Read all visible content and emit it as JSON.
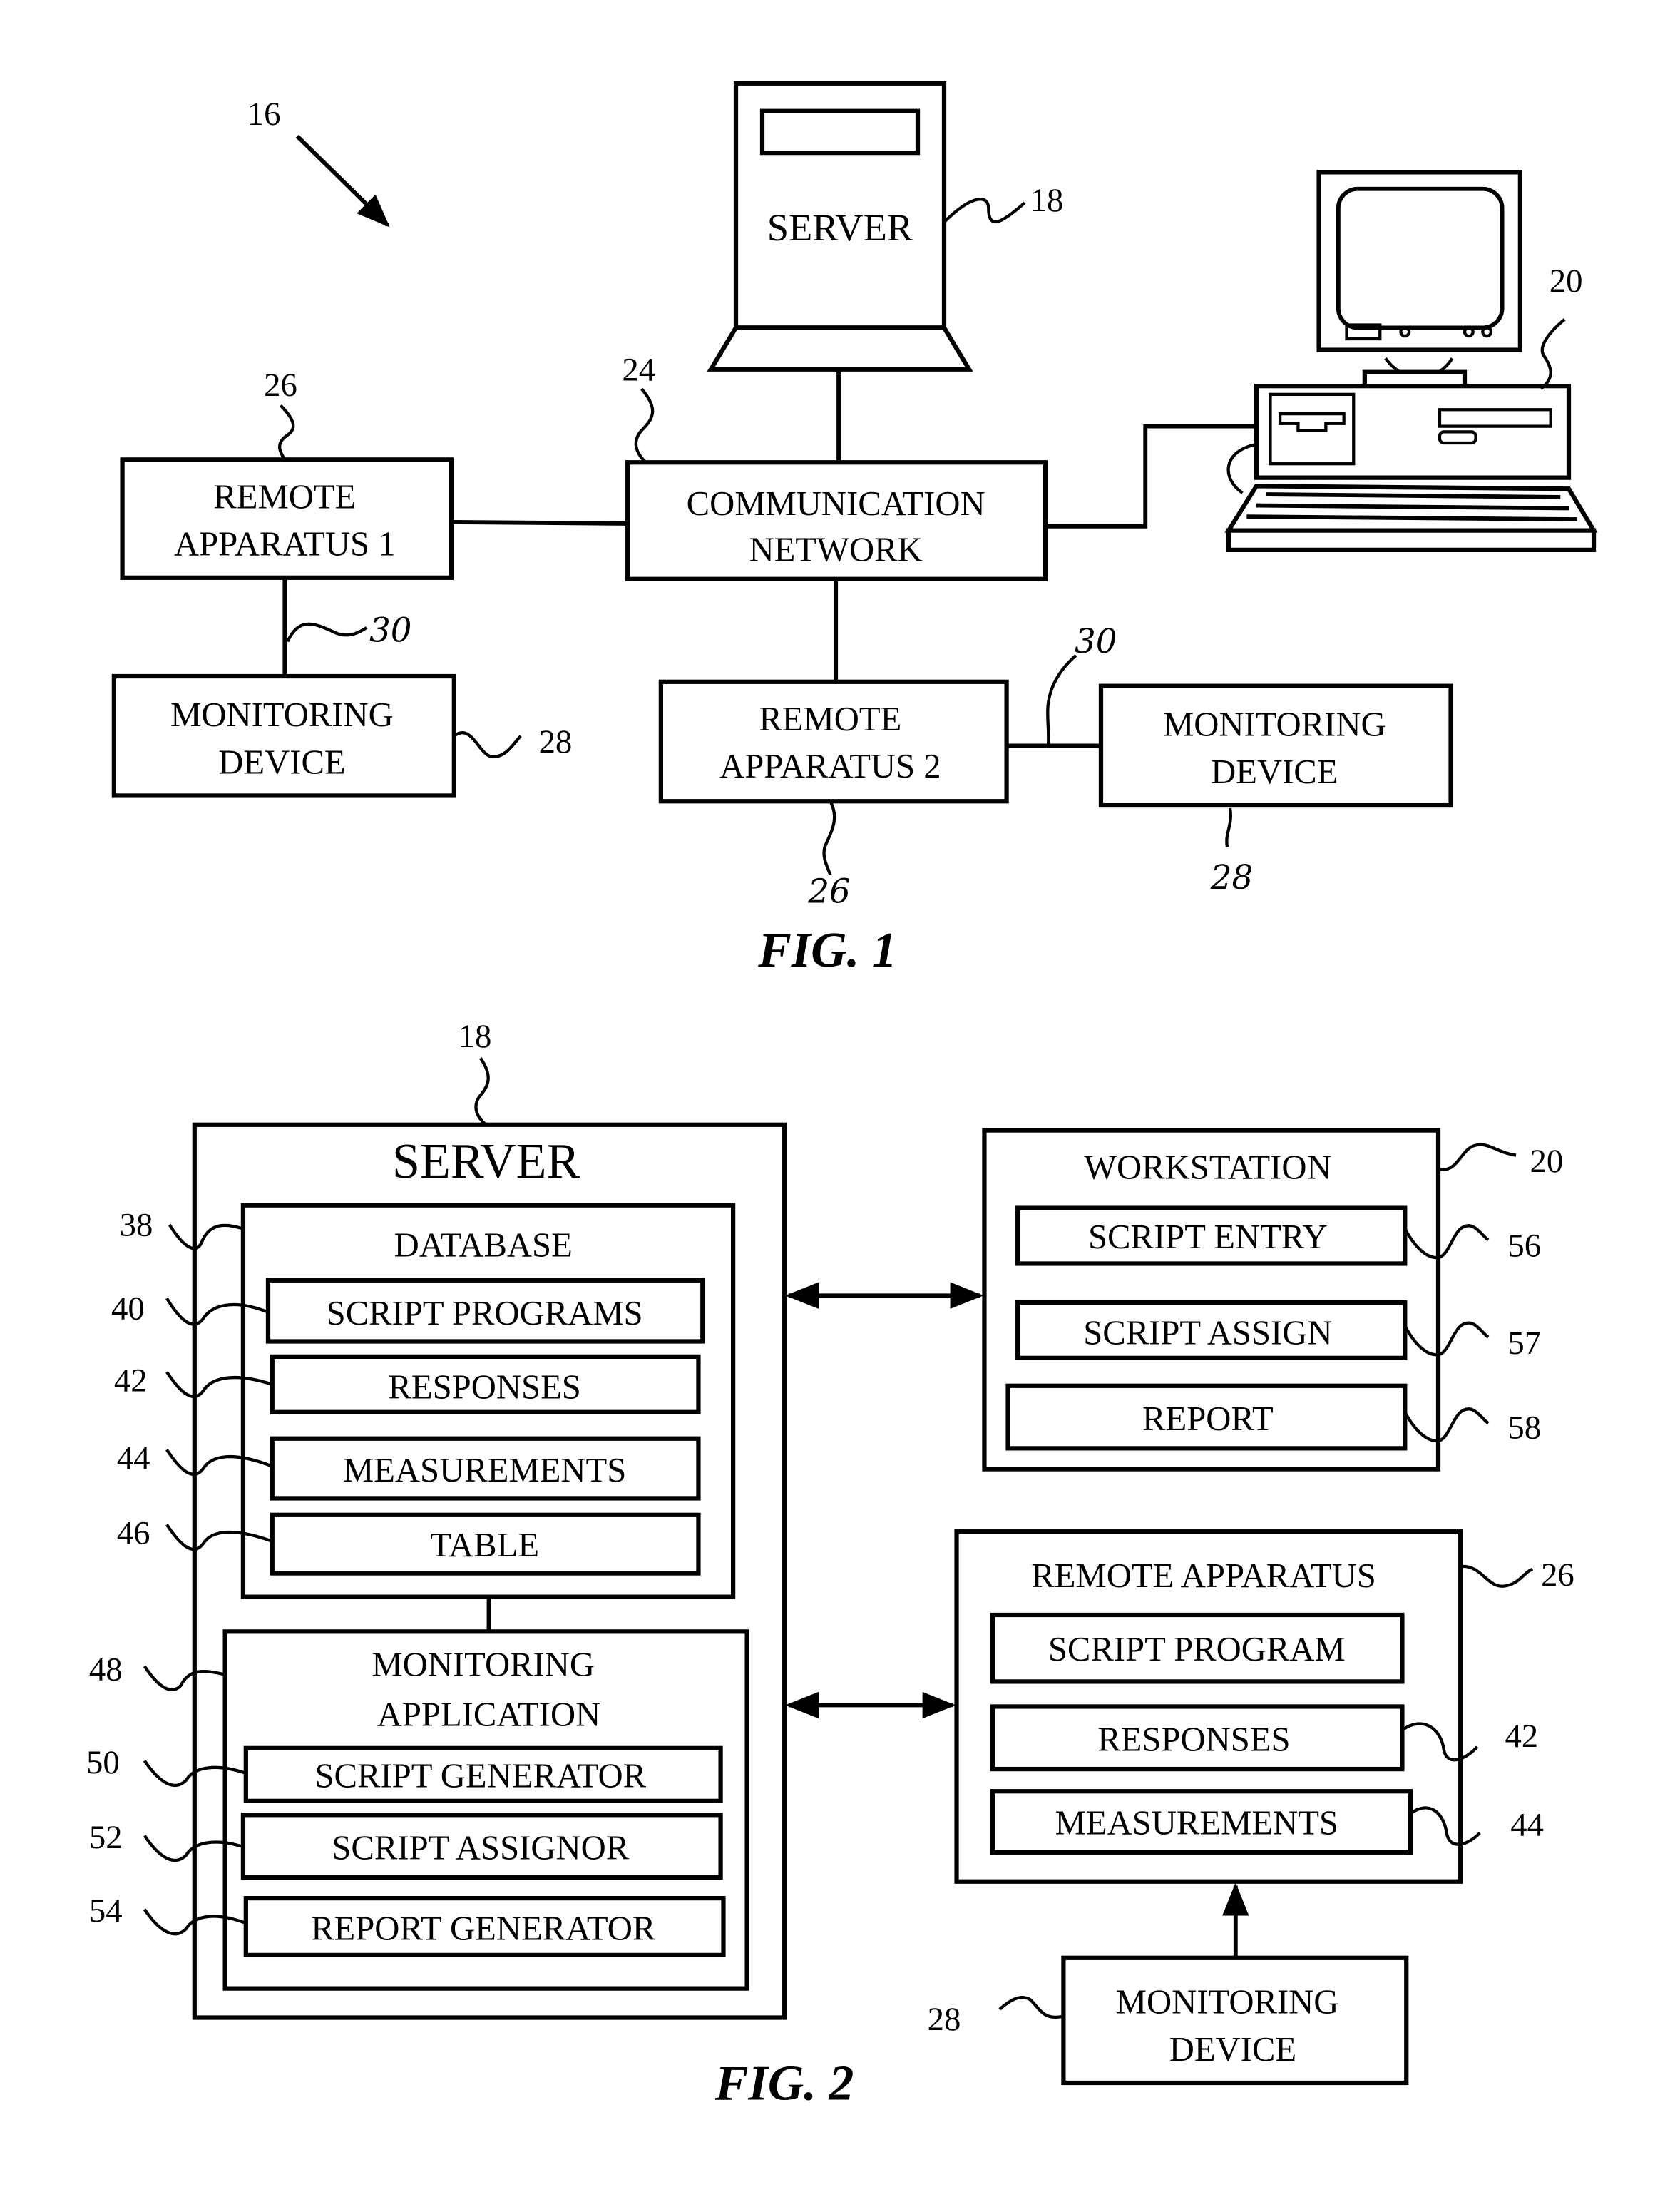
{
  "figure1": {
    "caption": "FIG. 1",
    "system_ref": "16",
    "server": {
      "label": "SERVER",
      "ref": "18"
    },
    "network": {
      "line1": "COMMUNICATION",
      "line2": "NETWORK",
      "ref": "24"
    },
    "workstation": {
      "ref": "20"
    },
    "remote1": {
      "line1": "REMOTE",
      "line2": "APPARATUS 1",
      "ref": "26",
      "link_ref": "30"
    },
    "monitor1": {
      "line1": "MONITORING",
      "line2": "DEVICE",
      "ref": "28"
    },
    "remote2": {
      "line1": "REMOTE",
      "line2": "APPARATUS 2",
      "ref": "26",
      "link_ref": "30"
    },
    "monitor2": {
      "line1": "MONITORING",
      "line2": "DEVICE",
      "ref": "28"
    }
  },
  "figure2": {
    "caption": "FIG. 2",
    "server": {
      "title": "SERVER",
      "ref": "18",
      "database": {
        "title": "DATABASE",
        "ref": "38",
        "items": [
          {
            "label": "SCRIPT PROGRAMS",
            "ref": "40"
          },
          {
            "label": "RESPONSES",
            "ref": "42"
          },
          {
            "label": "MEASUREMENTS",
            "ref": "44"
          },
          {
            "label": "TABLE",
            "ref": "46"
          }
        ]
      },
      "monitoring_app": {
        "line1": "MONITORING",
        "line2": "APPLICATION",
        "ref": "48",
        "items": [
          {
            "label": "SCRIPT GENERATOR",
            "ref": "50"
          },
          {
            "label": "SCRIPT ASSIGNOR",
            "ref": "52"
          },
          {
            "label": "REPORT GENERATOR",
            "ref": "54"
          }
        ]
      }
    },
    "workstation": {
      "title": "WORKSTATION",
      "ref": "20",
      "items": [
        {
          "label": "SCRIPT ENTRY",
          "ref": "56"
        },
        {
          "label": "SCRIPT ASSIGN",
          "ref": "57"
        },
        {
          "label": "REPORT",
          "ref": "58"
        }
      ]
    },
    "remote_apparatus": {
      "title": "REMOTE APPARATUS",
      "ref": "26",
      "items": [
        {
          "label": "SCRIPT PROGRAM",
          "ref": ""
        },
        {
          "label": "RESPONSES",
          "ref": "42"
        },
        {
          "label": "MEASUREMENTS",
          "ref": "44"
        }
      ]
    },
    "monitoring_device": {
      "line1": "MONITORING",
      "line2": "DEVICE",
      "ref": "28"
    }
  }
}
